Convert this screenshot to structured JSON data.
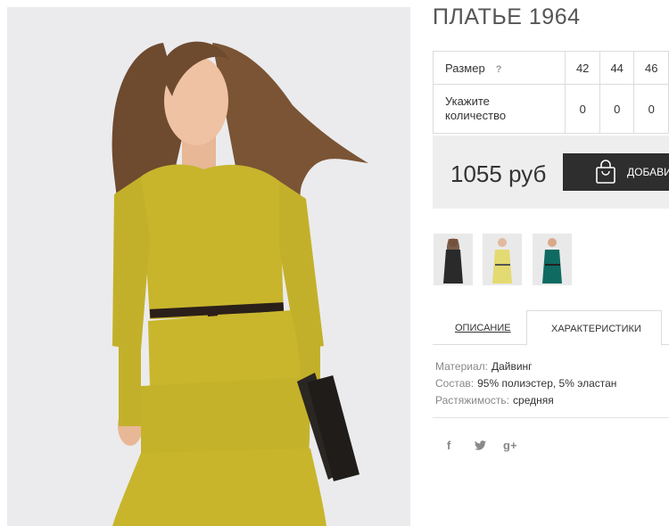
{
  "product": {
    "title": "ПЛАТЬЕ 1964",
    "image_alt": "Model in yellow dress with belt and clutch"
  },
  "size_table": {
    "size_label": "Размер",
    "help_icon": "?",
    "sizes": [
      "42",
      "44",
      "46"
    ],
    "qty_label": "Укажите количество",
    "quantities": [
      "0",
      "0",
      "0"
    ]
  },
  "buy": {
    "price": "1055 руб",
    "add_label": "ДОБАВИТЬ",
    "icon": "shopping-bag-icon"
  },
  "thumbnails": [
    {
      "color": "#2a2a2a",
      "name": "black"
    },
    {
      "color": "#e3da72",
      "name": "yellow"
    },
    {
      "color": "#0f6b62",
      "name": "teal"
    }
  ],
  "tabs": {
    "description": "ОПИСАНИЕ",
    "specs": "ХАРАКТЕРИСТИКИ"
  },
  "specs": [
    {
      "key": "Материал:",
      "value": "Дайвинг"
    },
    {
      "key": "Состав:",
      "value": "95% полиэстер, 5% эластан"
    },
    {
      "key": "Растяжимость:",
      "value": "средняя"
    }
  ],
  "social": {
    "facebook": "f",
    "twitter_icon": "twitter-icon",
    "google": "g+"
  },
  "colors": {
    "dress": "#c8b52c",
    "button": "#2e2e2e",
    "buybox_bg": "#eeeeee"
  }
}
